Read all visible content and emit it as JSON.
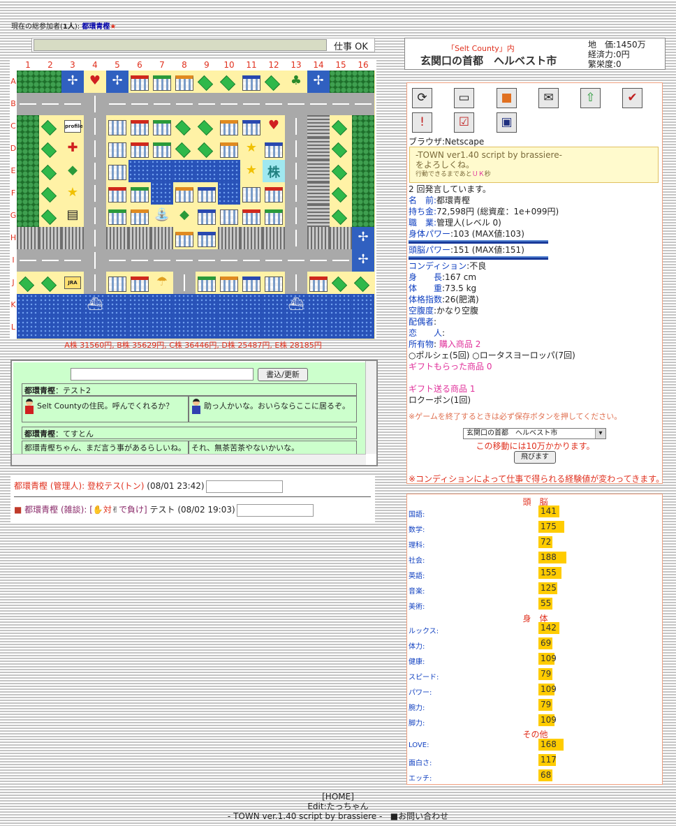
{
  "participants": {
    "label": "現在の総参加者(",
    "count": "1人",
    "suffix": "):",
    "user": "都環青樫",
    "star": "★"
  },
  "workbar": {
    "label": "仕事",
    "status": "OK"
  },
  "city": {
    "county": "「Selt County」内",
    "name": "玄関口の首都　ヘルベスト市",
    "land_price": "地　価:1450万",
    "economy": "経済力:0円",
    "prosperity": "繁栄度:0"
  },
  "map": {
    "columns": [
      "1",
      "2",
      "3",
      "4",
      "5",
      "6",
      "7",
      "8",
      "9",
      "10",
      "11",
      "12",
      "13",
      "14",
      "15",
      "16"
    ],
    "rows": [
      "A",
      "B",
      "C",
      "D",
      "E",
      "F",
      "G",
      "H",
      "I",
      "J",
      "K",
      "L"
    ],
    "labels": {
      "profile": "profile",
      "bbs": "BBS",
      "kabu": "株",
      "jra": "JRA",
      "jleague": "Jリーグ",
      "life": "人生ゲーム"
    }
  },
  "stocks": "A株 31560円, B株 35629円, C株 36446円, D株 25487円, E株 28185円",
  "chat": {
    "button": "書込/更新",
    "entries": [
      {
        "author": "都環青樫",
        "title": "テスト2",
        "left": "Selt Countyの住民。呼んでくれるか？",
        "right": "助っ人かいな。おいらならここに居るぞ。"
      },
      {
        "author": "都環青樫",
        "title": "てすとん",
        "left": "都環青樫ちゃん、まだ言う事があるらしいね。",
        "right": "それ、無茶苦茶やないかいな。"
      }
    ]
  },
  "posts": [
    {
      "author": "都環青樫 (管理人):",
      "title": "登校テス(トン)",
      "date": "(08/01 23:42)"
    },
    {
      "author": "都環青樫 (雑談):",
      "vs": "[",
      "vs2": "対",
      "vs3": "で負け]",
      "title": "テスト",
      "date": "(08/02 19:03)"
    }
  ],
  "status": {
    "browser": "ブラウザ:Netscape",
    "msg1": "-TOWN ver1.40 script by brassiere-",
    "msg2": "をよろしくね。",
    "msg3a": "行動できるまであと",
    "msg3b": "ＵＫ",
    "msg3c": "秒",
    "posts": "2 回発言しています。",
    "name_label": "名　前:",
    "name": "都環青樫",
    "money_label": "持ち金:",
    "money": "72,598円 (総資産：1e+099円)",
    "job_label": "職　業:",
    "job": "管理人(レベル 0)",
    "body_label": "身体パワー",
    "body": ":103 (MAX値:103)",
    "brain_label": "頭脳パワー",
    "brain": ":151 (MAX値:151)",
    "cond_label": "コンディション",
    "cond": ":不良",
    "height_label": "身　　長",
    "height": ":167 cm",
    "weight_label": "体　　重",
    "weight": ":73.5 kg",
    "bmi_label": "体格指数",
    "bmi": ":26(肥満)",
    "hunger_label": "空腹度",
    "hunger": ":かなり空腹",
    "spouse_label": "配偶者",
    "spouse": ":",
    "lover_label": "恋　　人",
    "lover": ":",
    "items_label": "所有物",
    "items_bought": "購入商品 2",
    "items": "○ポルシェ(5回) ○ロータスヨーロッパ(7回)",
    "gift_recv": "ギフトもらった商品 0",
    "gift_send": "ギフト送る商品 1",
    "coupon": "ロクーポン(1回)",
    "save_note": "※ゲームを終了するときは必ず保存ボタンを押してください。",
    "city_select": "玄関口の首都　ヘルベスト市",
    "move_msg": "この移動には10万かかります。",
    "fly": "飛びます",
    "cond_note": "※コンディションによって仕事で得られる経験値が変わってきます。"
  },
  "attributes": {
    "brain_head": "頭　脳",
    "brain": [
      {
        "label": "国語:",
        "value": 141
      },
      {
        "label": "数学:",
        "value": 175
      },
      {
        "label": "理科:",
        "value": 72
      },
      {
        "label": "社会:",
        "value": 188
      },
      {
        "label": "英語:",
        "value": 155
      },
      {
        "label": "音楽:",
        "value": 125
      },
      {
        "label": "美術:",
        "value": 55
      }
    ],
    "body_head": "身　体",
    "body": [
      {
        "label": "ルックス:",
        "value": 142
      },
      {
        "label": "体力:",
        "value": 69
      },
      {
        "label": "健康:",
        "value": 109
      },
      {
        "label": "スピード:",
        "value": 79
      },
      {
        "label": "パワー:",
        "value": 109
      },
      {
        "label": "腕力:",
        "value": 79
      },
      {
        "label": "脚力:",
        "value": 109
      }
    ],
    "other_head": "その他",
    "other": [
      {
        "label": "LOVE:",
        "value": 168
      },
      {
        "label": "面白さ:",
        "value": 117
      },
      {
        "label": "エッチ:",
        "value": 68
      }
    ]
  },
  "footer": {
    "home": "[HOME]",
    "edit": "Edit:たっちゃん",
    "credit": "- TOWN ver.1.40 script by brassiere -",
    "contact": "■お問い合わせ"
  },
  "colors": {
    "accent": "#e0301e",
    "chat_bg": "#ccffcc",
    "stat_bar": "#ffcc00"
  }
}
